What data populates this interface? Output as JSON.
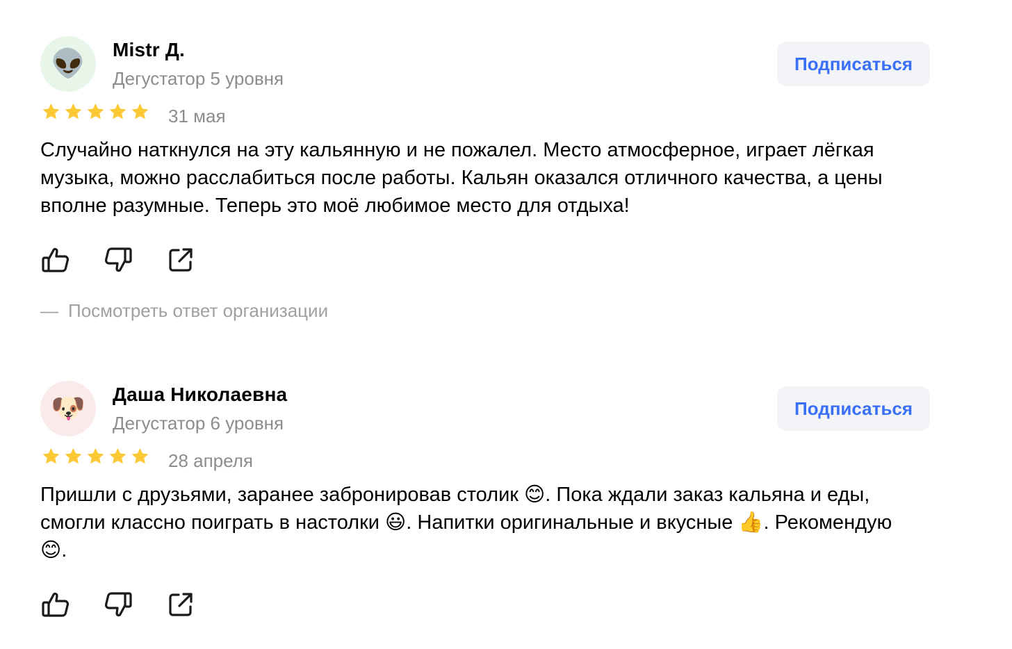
{
  "reviews": [
    {
      "author": {
        "name": "Mistr Д.",
        "level": "Дегустатор 5 уровня",
        "avatar_emoji": "👽",
        "avatar_bg": "#e7f6e9"
      },
      "subscribe_label": "Подписаться",
      "rating": 5,
      "date": "31 мая",
      "text": "Случайно наткнулся на эту кальянную и не пожалел. Место атмосферное, играет лёгкая музыка, можно расслабиться после работы. Кальян оказался отличного качества, а цены вполне разумные. Теперь это моё любимое место для отдыха!",
      "org_reply_dash": "—",
      "org_reply_link": "Посмотреть ответ организации"
    },
    {
      "author": {
        "name": "Даша Николаевна",
        "level": "Дегустатор 6 уровня",
        "avatar_emoji": "🐶",
        "avatar_bg": "#fbeaea"
      },
      "subscribe_label": "Подписаться",
      "rating": 5,
      "date": "28 апреля",
      "text": "Пришли с друзьями, заранее забронировав столик 😊. Пока ждали заказ кальяна и еды, смогли классно поиграть в настолки 😃. Напитки оригинальные и вкусные 👍. Рекомендую 😊."
    }
  ],
  "colors": {
    "star": "#fcc934",
    "accent": "#3a6ff7",
    "secondary_text": "#8c8c8c",
    "icon": "#1a1a1a"
  },
  "icons": {
    "like": "thumbs-up-icon",
    "dislike": "thumbs-down-icon",
    "share": "share-icon",
    "star": "star-icon"
  }
}
